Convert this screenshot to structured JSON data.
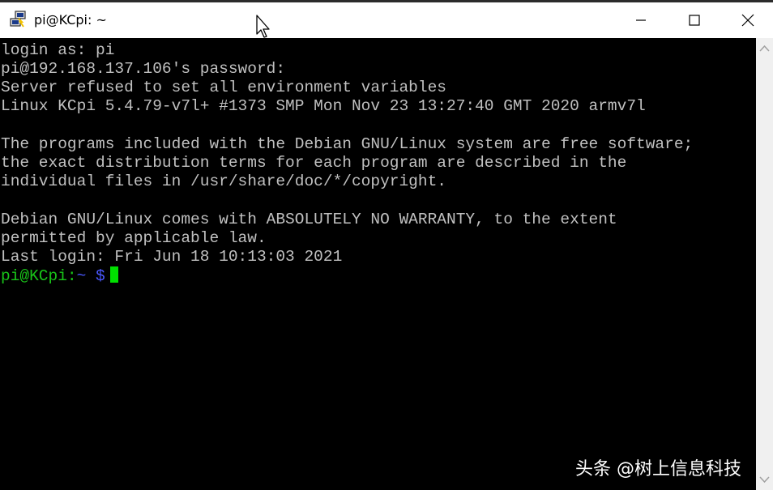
{
  "window": {
    "title": "pi@KCpi: ~",
    "icon": "putty-icon",
    "controls": {
      "minimize": "minimize-icon",
      "maximize": "maximize-icon",
      "close": "close-icon"
    }
  },
  "terminal": {
    "lines": [
      "login as: pi",
      "pi@192.168.137.106's password:",
      "Server refused to set all environment variables",
      "Linux KCpi 5.4.79-v7l+ #1373 SMP Mon Nov 23 13:27:40 GMT 2020 armv7l",
      "",
      "The programs included with the Debian GNU/Linux system are free software;",
      "the exact distribution terms for each program are described in the",
      "individual files in /usr/share/doc/*/copyright.",
      "",
      "Debian GNU/Linux comes with ABSOLUTELY NO WARRANTY, to the extent",
      "permitted by applicable law.",
      "Last login: Fri Jun 18 10:13:03 2021"
    ],
    "prompt": {
      "user_host": "pi@KCpi",
      "separator": ":",
      "path": "~",
      "symbol": "$"
    },
    "colors": {
      "text": "#c0c0c0",
      "prompt_user": "#19c419",
      "prompt_path": "#4a58ff",
      "cursor": "#00e000",
      "background": "#000000"
    }
  },
  "watermark": {
    "text": "头条 @树上信息科技"
  }
}
